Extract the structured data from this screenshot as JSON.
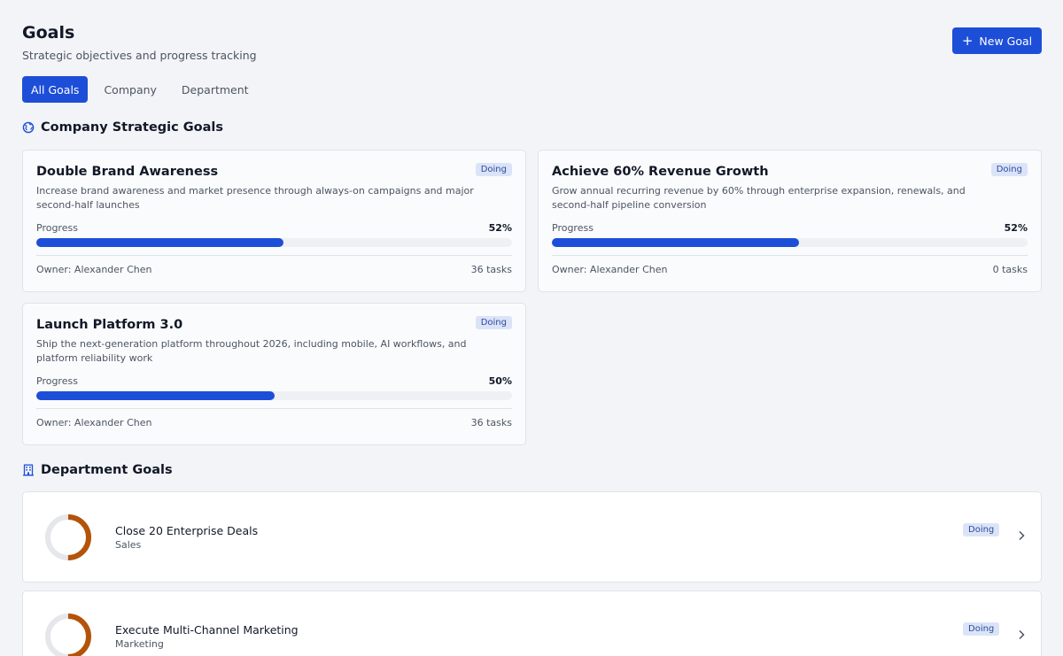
{
  "header": {
    "title": "Goals",
    "subtitle": "Strategic objectives and progress tracking",
    "new_goal_label": "New Goal"
  },
  "tabs": [
    {
      "label": "All Goals",
      "active": true
    },
    {
      "label": "Company",
      "active": false
    },
    {
      "label": "Department",
      "active": false
    }
  ],
  "company_section": {
    "title": "Company Strategic Goals",
    "icon": "globe-icon",
    "goals": [
      {
        "title": "Double Brand Awareness",
        "status": "Doing",
        "description": "Increase brand awareness and market presence through always-on campaigns and major second-half launches",
        "progress_label": "Progress",
        "progress_value": 52,
        "progress_text": "52%",
        "owner": "Owner: Alexander Chen",
        "tasks": "36 tasks"
      },
      {
        "title": "Achieve 60% Revenue Growth",
        "status": "Doing",
        "description": "Grow annual recurring revenue by 60% through enterprise expansion, renewals, and second-half pipeline conversion",
        "progress_label": "Progress",
        "progress_value": 52,
        "progress_text": "52%",
        "owner": "Owner: Alexander Chen",
        "tasks": "0 tasks"
      },
      {
        "title": "Launch Platform 3.0",
        "status": "Doing",
        "description": "Ship the next-generation platform throughout 2026, including mobile, AI workflows, and platform reliability work",
        "progress_label": "Progress",
        "progress_value": 50,
        "progress_text": "50%",
        "owner": "Owner: Alexander Chen",
        "tasks": "36 tasks"
      }
    ]
  },
  "department_section": {
    "title": "Department Goals",
    "icon": "building-icon",
    "goals": [
      {
        "title": "Close 20 Enterprise Deals",
        "department": "Sales",
        "status": "Doing",
        "progress_value": 50
      },
      {
        "title": "Execute Multi-Channel Marketing",
        "department": "Marketing",
        "status": "Doing",
        "progress_value": 50
      }
    ]
  },
  "colors": {
    "accent": "#1d4ed8",
    "ring_progress": "#b45309",
    "ring_track": "#e5e7eb",
    "badge_bg": "#dbe4f7",
    "badge_text": "#2c4aa0"
  }
}
